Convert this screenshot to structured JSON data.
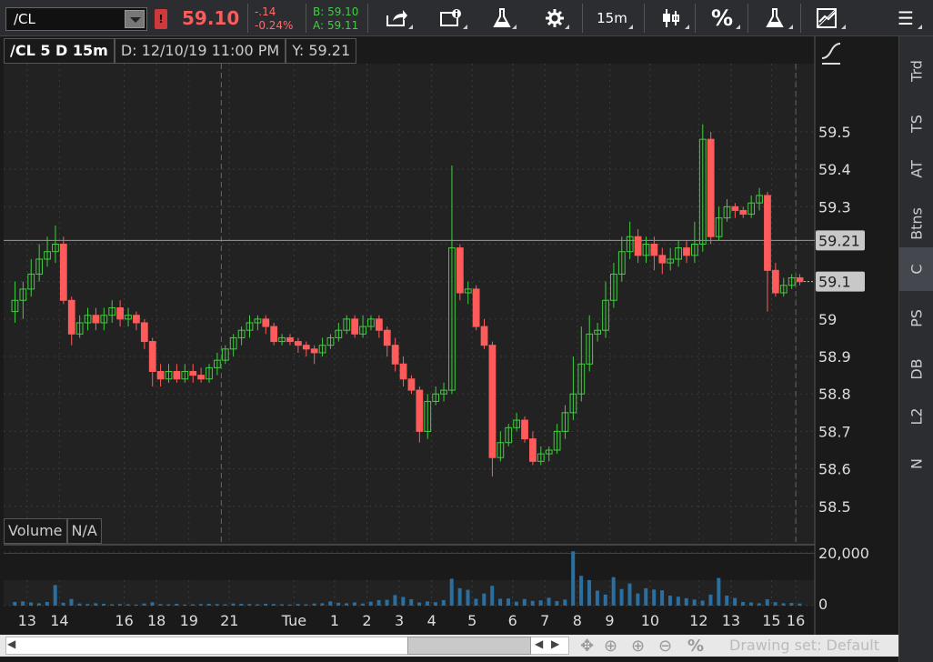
{
  "toolbar": {
    "symbol": "/CL",
    "alert": "!",
    "last": "59.10",
    "change": "-.14",
    "change_pct": "-0.24%",
    "bid": "B: 59.10",
    "ask": "A: 59.11",
    "timeframe": "15m",
    "percent": "%"
  },
  "chart_header": {
    "name": "/CL 5 D 15m",
    "date": "D: 12/10/19 11:00 PM",
    "y": "Y: 59.21"
  },
  "volume_header": {
    "label": "Volume",
    "value": "N/A"
  },
  "price_axis": [
    "59.5",
    "59.4",
    "59.3",
    "59.2",
    "59.1",
    "59",
    "58.9",
    "58.8",
    "58.7",
    "58.6",
    "58.5"
  ],
  "price_markers": {
    "cursor": "59.21",
    "last": "59.1"
  },
  "volume_axis": [
    "20,000",
    "0"
  ],
  "time_axis": [
    "13",
    "14",
    "16",
    "18",
    "19",
    "21",
    "Tue",
    "1",
    "2",
    "3",
    "4",
    "5",
    "6",
    "7",
    "8",
    "9",
    "10",
    "12",
    "13",
    "15",
    "16"
  ],
  "right_tabs": [
    "Trd",
    "TS",
    "AT",
    "Btns",
    "C",
    "PS",
    "DB",
    "L2",
    "N"
  ],
  "drawing_set": "Drawing set: Default",
  "colors": {
    "up": "#3ecf3e",
    "down": "#ff5b5b",
    "volume": "#2a6fa0",
    "grid": "#3a3a3a"
  },
  "chart_data": {
    "type": "candlestick",
    "ylim": [
      58.48,
      59.58
    ],
    "candles": [
      [
        59.02,
        59.05,
        58.99,
        59.1
      ],
      [
        59.05,
        59.08,
        59.0,
        59.1
      ],
      [
        59.08,
        59.12,
        59.06,
        59.16
      ],
      [
        59.12,
        59.16,
        59.1,
        59.2
      ],
      [
        59.16,
        59.18,
        59.14,
        59.22
      ],
      [
        59.18,
        59.2,
        59.15,
        59.25
      ],
      [
        59.2,
        59.05,
        59.04,
        59.22
      ],
      [
        59.05,
        58.96,
        58.93,
        59.06
      ],
      [
        58.96,
        58.99,
        58.95,
        59.01
      ],
      [
        58.99,
        59.01,
        58.97,
        59.03
      ],
      [
        59.01,
        58.99,
        58.97,
        59.03
      ],
      [
        58.99,
        59.01,
        58.97,
        59.03
      ],
      [
        59.01,
        59.03,
        58.99,
        59.05
      ],
      [
        59.03,
        59.0,
        58.98,
        59.05
      ],
      [
        59.0,
        59.01,
        58.98,
        59.03
      ],
      [
        59.01,
        58.99,
        58.97,
        59.02
      ],
      [
        58.99,
        58.94,
        58.92,
        59.0
      ],
      [
        58.94,
        58.86,
        58.82,
        58.95
      ],
      [
        58.86,
        58.84,
        58.82,
        58.88
      ],
      [
        58.84,
        58.86,
        58.83,
        58.88
      ],
      [
        58.86,
        58.84,
        58.83,
        58.88
      ],
      [
        58.84,
        58.86,
        58.83,
        58.88
      ],
      [
        58.86,
        58.85,
        58.83,
        58.88
      ],
      [
        58.85,
        58.84,
        58.83,
        58.87
      ],
      [
        58.84,
        58.87,
        58.83,
        58.88
      ],
      [
        58.87,
        58.89,
        58.85,
        58.91
      ],
      [
        58.89,
        58.92,
        58.88,
        58.93
      ],
      [
        58.92,
        58.95,
        58.9,
        58.96
      ],
      [
        58.95,
        58.97,
        58.93,
        58.98
      ],
      [
        58.97,
        58.99,
        58.95,
        59.01
      ],
      [
        58.99,
        59.0,
        58.97,
        59.01
      ],
      [
        59.0,
        58.98,
        58.96,
        59.01
      ],
      [
        58.98,
        58.94,
        58.93,
        58.99
      ],
      [
        58.94,
        58.95,
        58.93,
        58.96
      ],
      [
        58.95,
        58.94,
        58.93,
        58.96
      ],
      [
        58.94,
        58.93,
        58.91,
        58.95
      ],
      [
        58.93,
        58.92,
        58.9,
        58.94
      ],
      [
        58.92,
        58.91,
        58.88,
        58.93
      ],
      [
        58.91,
        58.93,
        58.9,
        58.95
      ],
      [
        58.93,
        58.95,
        58.92,
        58.96
      ],
      [
        58.95,
        58.97,
        58.94,
        58.99
      ],
      [
        58.97,
        59.0,
        58.96,
        59.01
      ],
      [
        59.0,
        58.96,
        58.95,
        59.01
      ],
      [
        58.96,
        58.98,
        58.95,
        59.01
      ],
      [
        58.98,
        59.0,
        58.97,
        59.01
      ],
      [
        59.0,
        58.97,
        58.95,
        59.01
      ],
      [
        58.97,
        58.93,
        58.9,
        58.98
      ],
      [
        58.93,
        58.88,
        58.86,
        58.95
      ],
      [
        58.88,
        58.84,
        58.82,
        58.9
      ],
      [
        58.84,
        58.81,
        58.8,
        58.85
      ],
      [
        58.81,
        58.7,
        58.67,
        58.82
      ],
      [
        58.7,
        58.78,
        58.68,
        58.8
      ],
      [
        58.78,
        58.8,
        58.77,
        58.82
      ],
      [
        58.8,
        58.81,
        58.78,
        58.83
      ],
      [
        58.81,
        59.19,
        58.8,
        59.41
      ],
      [
        59.19,
        59.07,
        59.05,
        59.2
      ],
      [
        59.07,
        59.08,
        59.04,
        59.1
      ],
      [
        59.08,
        58.98,
        58.97,
        59.09
      ],
      [
        58.98,
        58.93,
        58.92,
        59.0
      ],
      [
        58.93,
        58.63,
        58.58,
        58.94
      ],
      [
        58.63,
        58.67,
        58.62,
        58.7
      ],
      [
        58.67,
        58.71,
        58.66,
        58.72
      ],
      [
        58.71,
        58.73,
        58.7,
        58.75
      ],
      [
        58.73,
        58.68,
        58.67,
        58.74
      ],
      [
        58.68,
        58.62,
        58.61,
        58.7
      ],
      [
        58.62,
        58.64,
        58.61,
        58.66
      ],
      [
        58.64,
        58.65,
        58.62,
        58.66
      ],
      [
        58.65,
        58.7,
        58.64,
        58.72
      ],
      [
        58.7,
        58.75,
        58.68,
        58.77
      ],
      [
        58.75,
        58.8,
        58.73,
        58.9
      ],
      [
        58.8,
        58.88,
        58.78,
        58.98
      ],
      [
        58.88,
        58.96,
        58.86,
        59.01
      ],
      [
        58.96,
        58.97,
        58.94,
        58.99
      ],
      [
        58.97,
        59.05,
        58.95,
        59.1
      ],
      [
        59.05,
        59.12,
        59.03,
        59.15
      ],
      [
        59.12,
        59.18,
        59.1,
        59.22
      ],
      [
        59.18,
        59.22,
        59.16,
        59.26
      ],
      [
        59.22,
        59.17,
        59.15,
        59.24
      ],
      [
        59.17,
        59.2,
        59.15,
        59.22
      ],
      [
        59.2,
        59.17,
        59.13,
        59.22
      ],
      [
        59.17,
        59.15,
        59.12,
        59.19
      ],
      [
        59.15,
        59.16,
        59.13,
        59.19
      ],
      [
        59.16,
        59.19,
        59.14,
        59.21
      ],
      [
        59.19,
        59.17,
        59.15,
        59.21
      ],
      [
        59.17,
        59.2,
        59.15,
        59.26
      ],
      [
        59.2,
        59.48,
        59.18,
        59.52
      ],
      [
        59.48,
        59.22,
        59.2,
        59.5
      ],
      [
        59.22,
        59.27,
        59.21,
        59.3
      ],
      [
        59.27,
        59.3,
        59.26,
        59.32
      ],
      [
        59.3,
        59.29,
        59.27,
        59.31
      ],
      [
        59.29,
        59.28,
        59.27,
        59.3
      ],
      [
        59.28,
        59.31,
        59.27,
        59.33
      ],
      [
        59.31,
        59.33,
        59.29,
        59.35
      ],
      [
        59.33,
        59.13,
        59.02,
        59.34
      ],
      [
        59.13,
        59.07,
        59.06,
        59.15
      ],
      [
        59.07,
        59.09,
        59.06,
        59.11
      ],
      [
        59.09,
        59.11,
        59.08,
        59.12
      ],
      [
        59.11,
        59.1,
        59.09,
        59.12
      ]
    ],
    "volume_max": 20000,
    "volumes": [
      1400,
      1600,
      1200,
      900,
      1400,
      7800,
      1100,
      2500,
      800,
      600,
      900,
      700,
      500,
      600,
      500,
      400,
      800,
      1300,
      600,
      500,
      700,
      400,
      500,
      600,
      700,
      600,
      500,
      800,
      700,
      600,
      500,
      700,
      600,
      500,
      400,
      600,
      500,
      800,
      900,
      1600,
      1100,
      900,
      1200,
      800,
      1500,
      2100,
      2200,
      4000,
      3300,
      2400,
      1200,
      1600,
      1300,
      2100,
      10200,
      6600,
      6000,
      2600,
      4600,
      7500,
      2600,
      2700,
      1500,
      2500,
      1800,
      2000,
      3000,
      1700,
      2300,
      20600,
      11300,
      9700,
      5700,
      4200,
      10800,
      6300,
      8400,
      4600,
      6600,
      6100,
      5800,
      3800,
      3400,
      2800,
      2300,
      1900,
      4200,
      10500,
      3800,
      2900,
      1400,
      1200,
      900,
      2400,
      1300,
      900,
      1000,
      800
    ]
  }
}
